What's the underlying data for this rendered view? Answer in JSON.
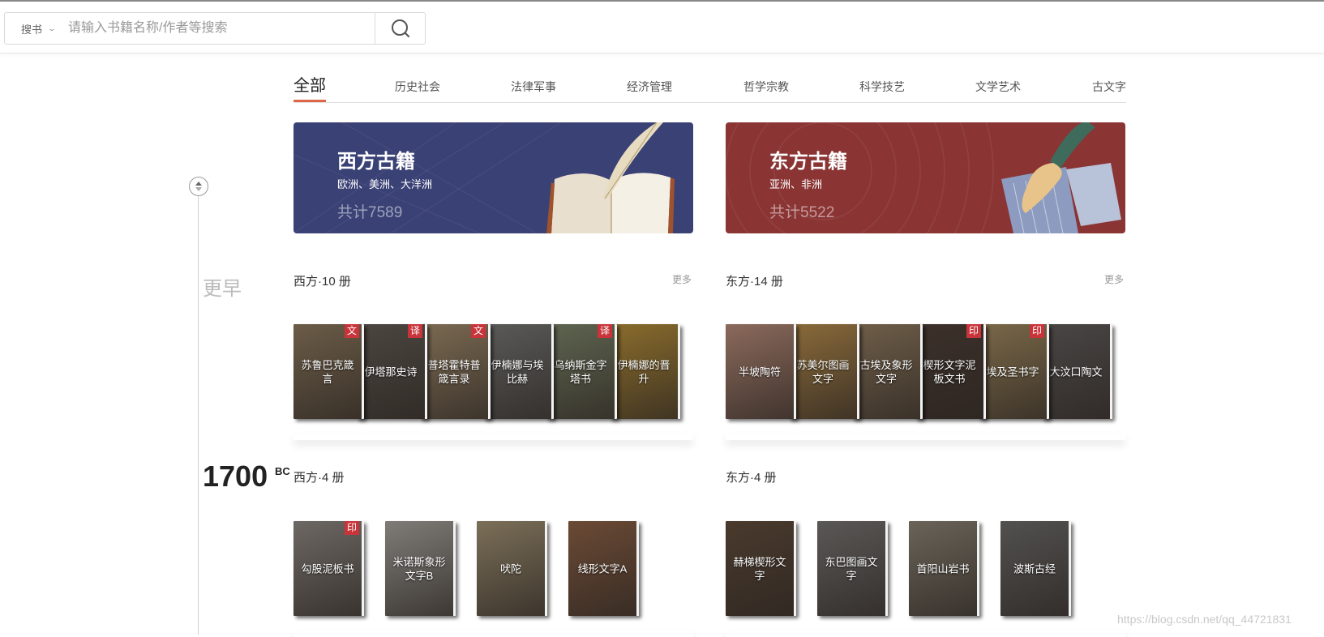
{
  "header": {
    "search_type": "搜书",
    "search_placeholder": "请输入书籍名称/作者等搜索"
  },
  "tabs": [
    "全部",
    "历史社会",
    "法律军事",
    "经济管理",
    "哲学宗教",
    "科学技艺",
    "文学艺术",
    "古文字"
  ],
  "active_tab": 0,
  "banners": {
    "west": {
      "title": "西方古籍",
      "subtitle": "欧洲、美洲、大洋洲",
      "count": "共计7589"
    },
    "east": {
      "title": "东方古籍",
      "subtitle": "亚洲、非洲",
      "count": "共计5522"
    }
  },
  "timeline": {
    "earlier": "更早",
    "year": "1700",
    "era": "BC"
  },
  "sections": [
    {
      "west": {
        "title": "西方·10 册",
        "more": "更多",
        "books": [
          {
            "title": "苏鲁巴克箴言",
            "tag": "文",
            "color": "#6b5c47"
          },
          {
            "title": "伊塔那史诗",
            "tag": "译",
            "color": "#4c4641"
          },
          {
            "title": "普塔霍特普箴言录",
            "tag": "文",
            "color": "#7b6a52"
          },
          {
            "title": "伊楠娜与埃比赫",
            "tag": "",
            "color": "#5a5a58"
          },
          {
            "title": "乌纳斯金字塔书",
            "tag": "译",
            "color": "#5f6550"
          },
          {
            "title": "伊楠娜的晋升",
            "tag": "",
            "color": "#8a6c2c"
          }
        ]
      },
      "east": {
        "title": "东方·14 册",
        "more": "更多",
        "books": [
          {
            "title": "半坡陶符",
            "tag": "",
            "color": "#8b6a5c"
          },
          {
            "title": "苏美尔图画文字",
            "tag": "",
            "color": "#8a6a3a"
          },
          {
            "title": "古埃及象形文字",
            "tag": "",
            "color": "#6f5e49"
          },
          {
            "title": "楔形文字泥板文书",
            "tag": "印",
            "color": "#3c302a"
          },
          {
            "title": "埃及圣书字",
            "tag": "印",
            "color": "#7a6848"
          },
          {
            "title": "大汶口陶文",
            "tag": "",
            "color": "#4a4645"
          }
        ]
      }
    },
    {
      "west": {
        "title": "西方·4 册",
        "books": [
          {
            "title": "勾股泥板书",
            "tag": "印",
            "color": "#6d6863"
          },
          {
            "title": "米诺斯象形文字B",
            "tag": "",
            "color": "#7f7c78"
          },
          {
            "title": "吠陀",
            "tag": "",
            "color": "#7b6f58"
          },
          {
            "title": "线形文字A",
            "tag": "",
            "color": "#6b4a35"
          }
        ]
      },
      "east": {
        "title": "东方·4 册",
        "books": [
          {
            "title": "赫梯楔形文字",
            "tag": "",
            "color": "#4a3a2d"
          },
          {
            "title": "东巴图画文字",
            "tag": "",
            "color": "#5a5856"
          },
          {
            "title": "首阳山岩书",
            "tag": "",
            "color": "#6a6358"
          },
          {
            "title": "波斯古经",
            "tag": "",
            "color": "#525150"
          }
        ]
      }
    }
  ],
  "watermark": "https://blog.csdn.net/qq_44721831"
}
